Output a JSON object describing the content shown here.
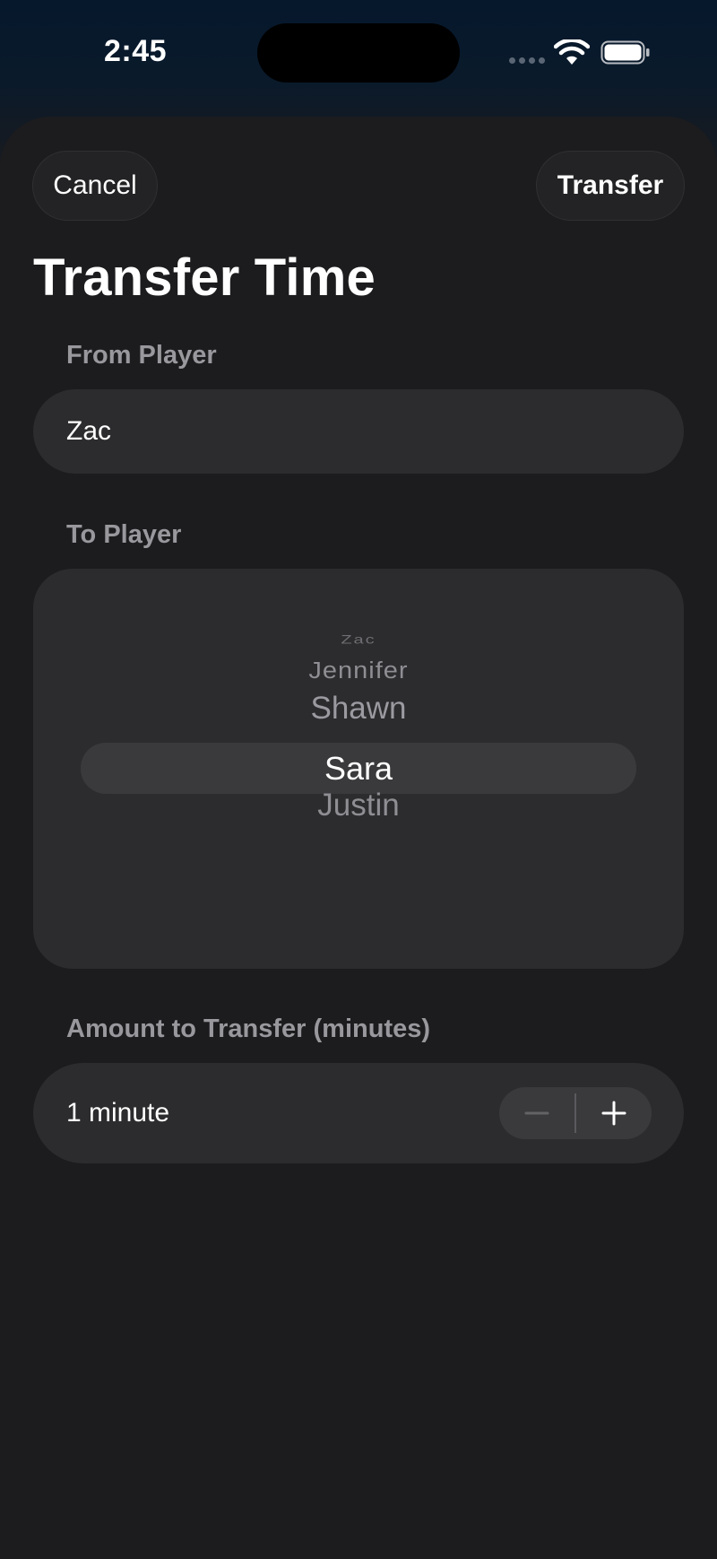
{
  "status_bar": {
    "time": "2:45"
  },
  "nav": {
    "cancel_label": "Cancel",
    "transfer_label": "Transfer"
  },
  "title": "Transfer Time",
  "from_player": {
    "label": "From Player",
    "value": "Zac"
  },
  "to_player": {
    "label": "To Player",
    "options": [
      "Zac",
      "Jennifer",
      "Shawn",
      "Sara",
      "Justin"
    ],
    "selected": "Sara"
  },
  "amount": {
    "label": "Amount to Transfer (minutes)",
    "value_text": "1 minute",
    "decrement_icon": "minus-icon",
    "increment_icon": "plus-icon"
  },
  "colors": {
    "background": "#1c1c1e",
    "field": "#2c2c2e",
    "secondary_text": "#98989d"
  }
}
